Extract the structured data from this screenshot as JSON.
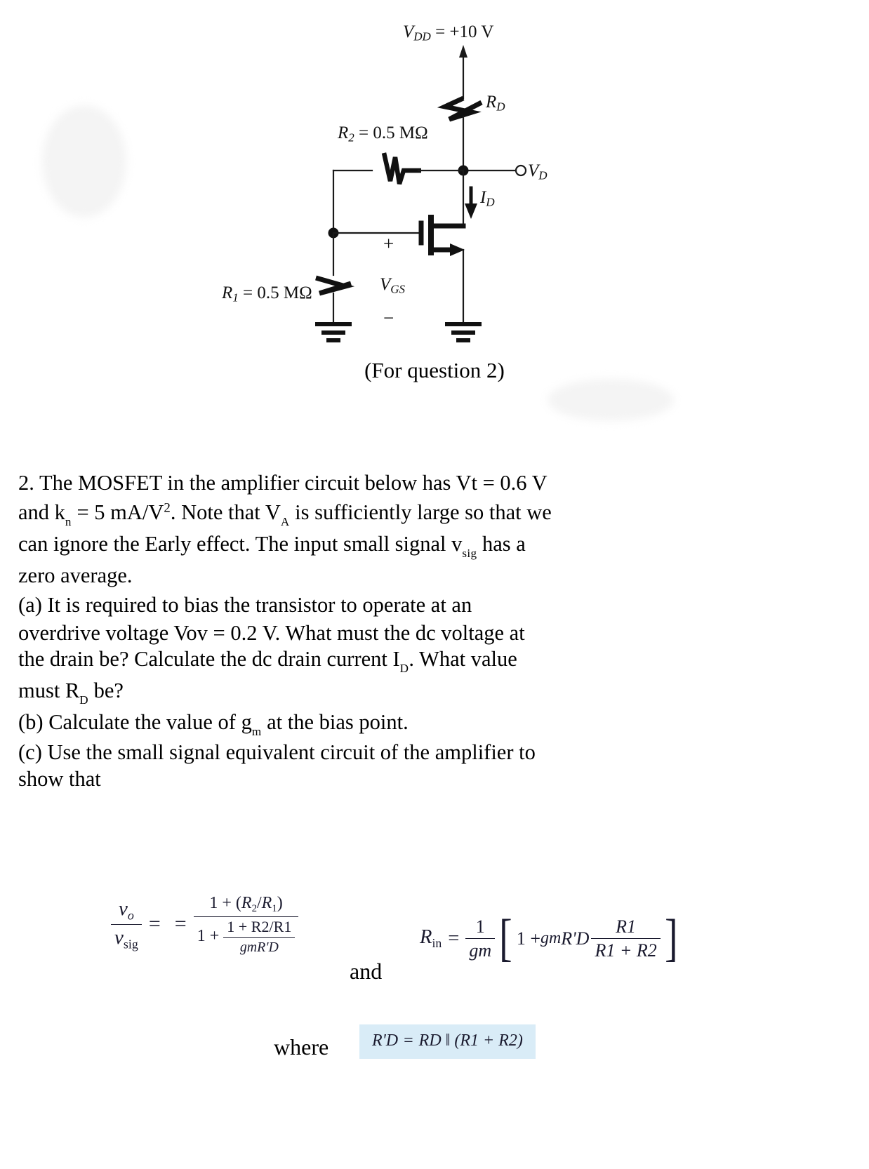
{
  "figure": {
    "caption": "(For question 2)",
    "labels": {
      "vdd": "VDD = +10 V",
      "vdd_name": "V",
      "vdd_sub": "DD",
      "vdd_value": " = +10 V",
      "rd": "RD",
      "rd_name": "R",
      "rd_sub": "D",
      "r2": "R2 = 0.5 MΩ",
      "r2_name": "R",
      "r2_sub": "2",
      "r2_value": " = 0.5 MΩ",
      "r1": "R1 = 0.5 MΩ",
      "r1_name": "R",
      "r1_sub": "1",
      "r1_value": " = 0.5 MΩ",
      "vd": "VD",
      "vd_name": "V",
      "vd_sub": "D",
      "id": "ID",
      "id_name": "I",
      "id_sub": "D",
      "vgs": "VGS",
      "vgs_name": "V",
      "vgs_sub": "GS",
      "plus": "+",
      "minus": "−"
    }
  },
  "problem": {
    "number": "2.",
    "line1_a": "2. The MOSFET in the amplifier circuit below has Vt = 0.6 V",
    "line2_a": "and k",
    "line2_sub": "n",
    "line2_b": " = 5 mA/V",
    "line2_sup": "2",
    "line2_c": ". Note that V",
    "line2_sub2": "A",
    "line2_d": " is sufficiently large so that we",
    "line3_a": "can ignore the Early effect. The input small signal v",
    "line3_sub": "sig",
    "line3_b": " has a",
    "line4": "zero average.",
    "parts": {
      "a_line1": "(a) It is required to bias the transistor to operate at an",
      "a_line2": "overdrive voltage Vov = 0.2 V. What must the dc voltage at",
      "a_line3_a": "the drain be? Calculate the dc drain current I",
      "a_line3_sub": "D",
      "a_line3_b": ". What value",
      "a_line4_a": "must R",
      "a_line4_sub": "D",
      "a_line4_b": " be?",
      "b_line1_a": "(b) Calculate the value of g",
      "b_line1_sub": "m",
      "b_line1_b": " at the bias point.",
      "c_line1": "(c) Use the small signal equivalent circuit of the amplifier to",
      "c_line2": "show that"
    }
  },
  "math": {
    "gain": {
      "lhs_num_var": "v",
      "lhs_num_sub": "o",
      "lhs_den_var": "v",
      "lhs_den_sub": "sig",
      "eq1": "=",
      "eq2": "=",
      "rhs_num": "1 + (R2/R1)",
      "rhs_num_plain_a": "1 + (",
      "rhs_num_r2": "R",
      "rhs_num_r2_sub": "2",
      "rhs_num_slash": "/",
      "rhs_num_r1": "R",
      "rhs_num_r1_sub": "1",
      "rhs_num_close": ")",
      "rhs_den_one_plus": "1 +",
      "rhs_den_inner_num": "1 + R2/R1",
      "rhs_den_inner_den": "gmR'D"
    },
    "and_word": "and",
    "rin": {
      "name": "R",
      "name_sub": "in",
      "eq": "=",
      "frac_num": "1",
      "frac_den": "gm",
      "bracket_open": "[",
      "body_a": "1 + ",
      "body_gm": "gm",
      "body_rd": "R'D",
      "inner_num": "R1",
      "inner_den": "R1 + R2",
      "bracket_close": "]"
    },
    "where_word": "where",
    "rd_prime": {
      "lhs": "R'D",
      "eq": "=",
      "rhs": "RD ‖ (R1 + R2)"
    }
  },
  "colors": {
    "highlight": "#d9ecf7",
    "ink": "#000000",
    "math_ink": "#1a1a2e"
  }
}
